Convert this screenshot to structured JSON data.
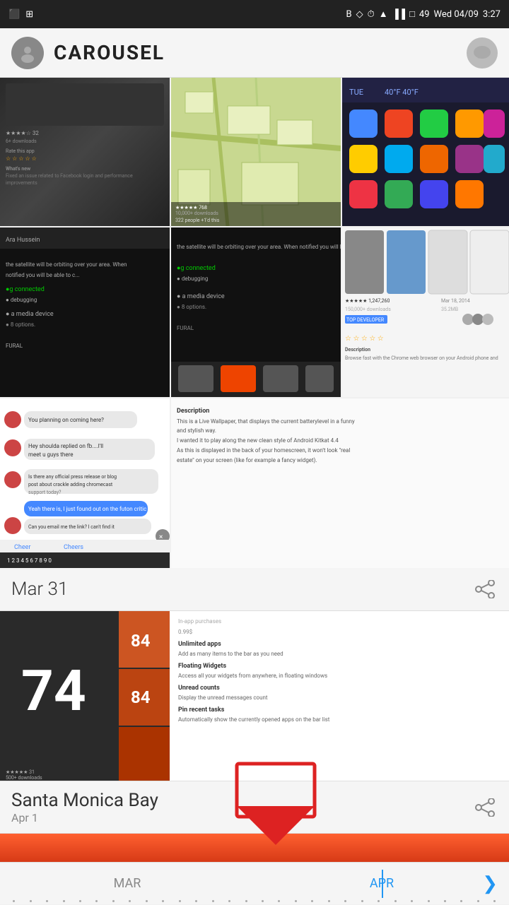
{
  "statusBar": {
    "time": "3:27",
    "date": "Wed 04/09",
    "battery": "49"
  },
  "header": {
    "appTitle": "CAROUSEL",
    "chatIconLabel": "chat"
  },
  "sections": [
    {
      "type": "photo-grid",
      "cells": [
        {
          "id": "cell-1",
          "description": "app-screenshot-dark"
        },
        {
          "id": "cell-2",
          "description": "maps-screenshot"
        },
        {
          "id": "cell-3",
          "description": "home-screen-icons"
        },
        {
          "id": "cell-4",
          "description": "debug-screenshot-dark"
        },
        {
          "id": "cell-5",
          "description": "media-device-screenshot"
        },
        {
          "id": "cell-6",
          "description": "app-store-screenshot"
        },
        {
          "id": "cell-7",
          "description": "chat-screenshot"
        },
        {
          "id": "cell-8",
          "description": "app-store-screenshot-2"
        }
      ]
    },
    {
      "type": "date-card",
      "date": "Mar 31",
      "shareLabel": "share"
    },
    {
      "type": "content-card",
      "batteryNumber": "74",
      "description": "Unlimited apps\nAdd as many items to the bar as you need\n\nFloating Widgets\nAccess all your widgets from anywhere, in floating windows\n\nUnread counts\nDisplay the unread messages count\n\nPin recent tasks\nAutomatically show the currently opened apps on the bar list"
    },
    {
      "type": "location-card",
      "title": "Santa Monica Bay",
      "subtitle": "Apr 1",
      "shareLabel": "share"
    }
  ],
  "timeline": {
    "months": [
      "MAR",
      "APR"
    ],
    "activeMonth": "APR",
    "chevronLabel": "next"
  },
  "arrow": {
    "label": "down arrow"
  }
}
